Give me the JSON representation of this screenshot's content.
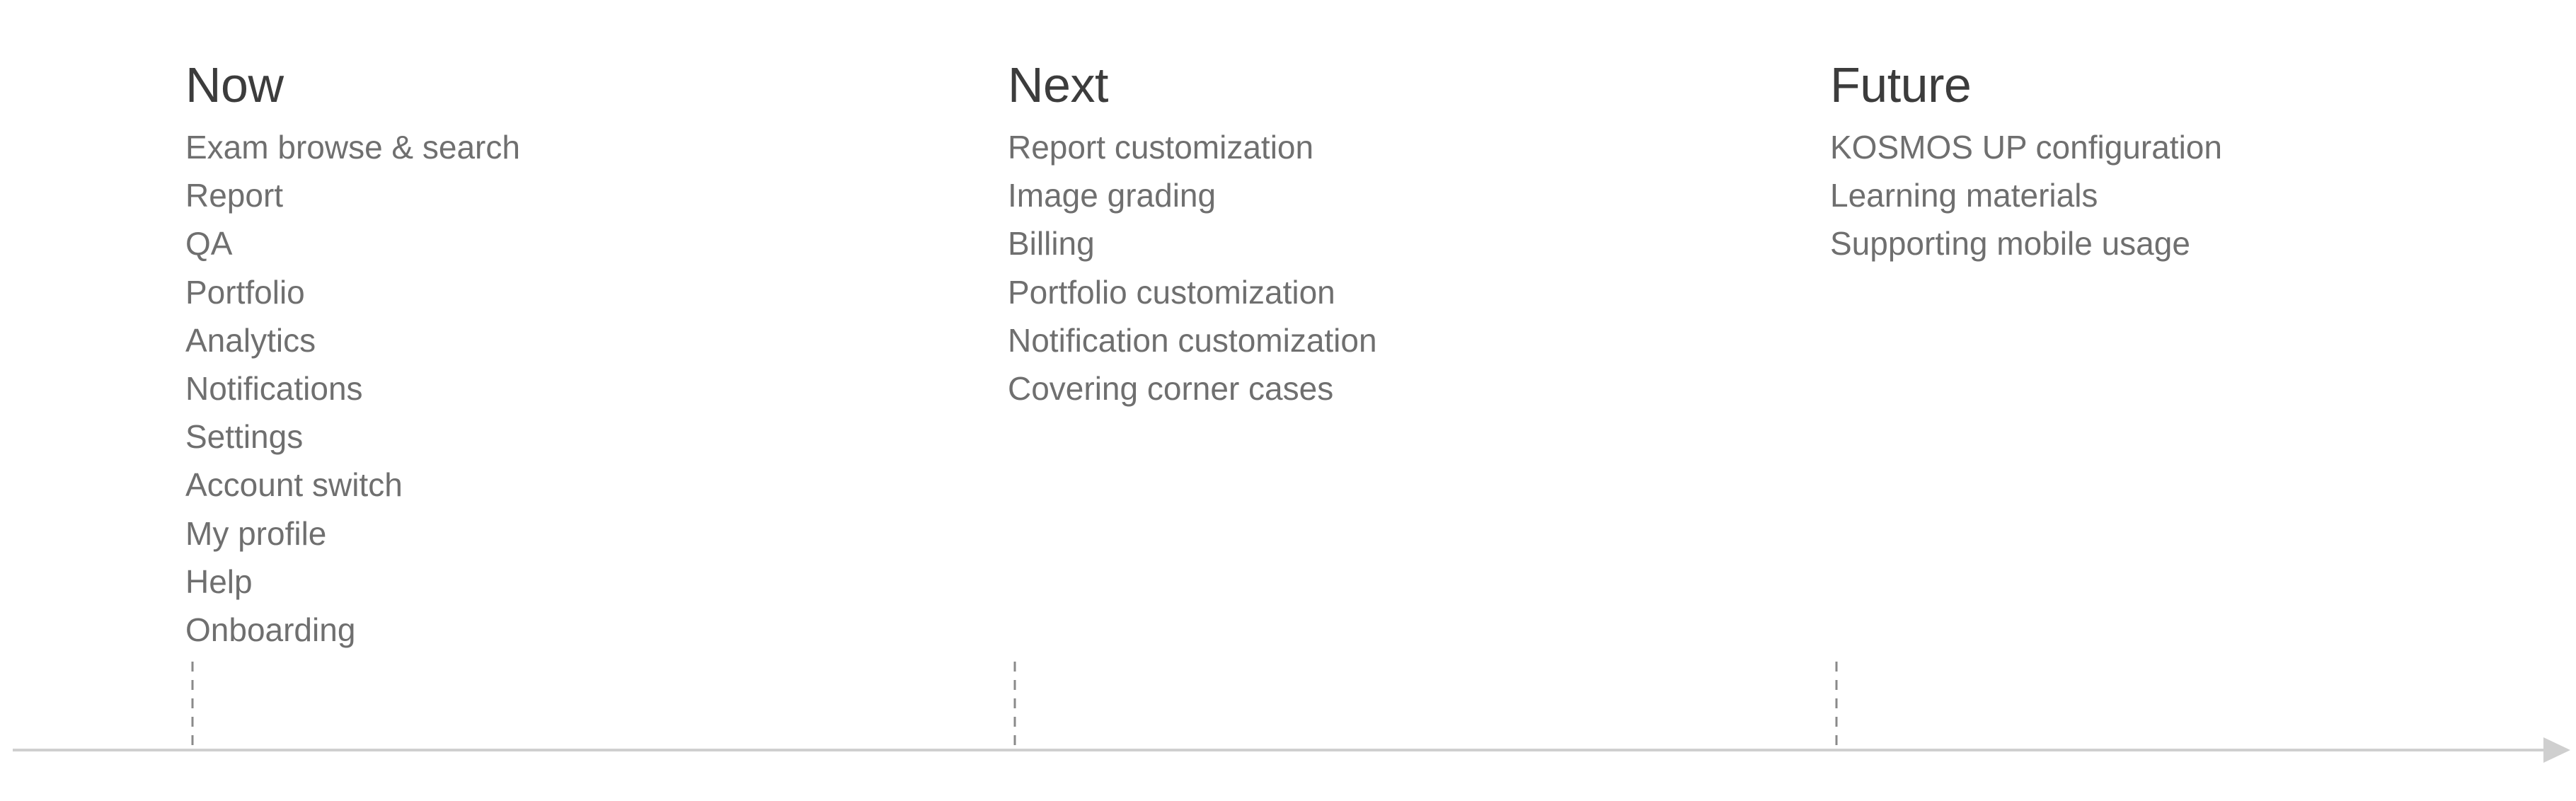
{
  "columns": [
    {
      "id": "now",
      "title": "Now",
      "items": [
        "Exam browse & search",
        "Report",
        "QA",
        "Portfolio",
        "Analytics",
        "Notifications",
        "Settings",
        "Account switch",
        "My profile",
        "Help",
        "Onboarding"
      ]
    },
    {
      "id": "next",
      "title": "Next",
      "items": [
        "Report customization",
        "Image grading",
        "Billing",
        "Portfolio customization",
        "Notification customization",
        "Covering corner cases"
      ]
    },
    {
      "id": "future",
      "title": "Future",
      "items": [
        "KOSMOS UP configuration",
        "Learning materials",
        "Supporting mobile usage"
      ]
    }
  ],
  "colors": {
    "title": "#3c3c3c",
    "item": "#6f6f6f",
    "axis": "#cfcfcf",
    "marker": "#8a8a8a"
  }
}
